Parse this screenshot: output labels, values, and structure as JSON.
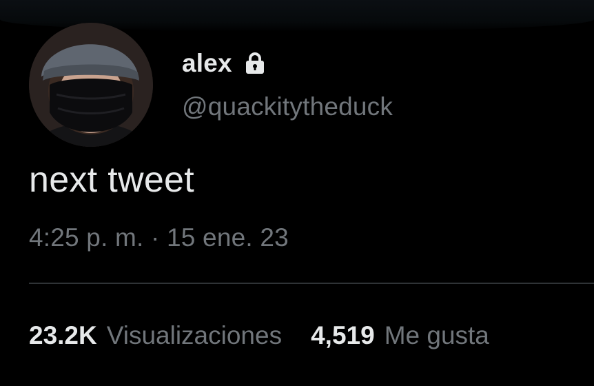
{
  "tweet": {
    "author": {
      "display_name": "alex",
      "handle": "@quackitytheduck",
      "protected_icon": "lock-icon",
      "avatar": "profile-avatar"
    },
    "text": "next tweet",
    "timestamp": "4:25 p. m. · 15 ene. 23",
    "stats": {
      "views_count": "23.2K",
      "views_label": "Visualizaciones",
      "likes_count": "4,519",
      "likes_label": "Me gusta"
    }
  },
  "colors": {
    "background": "#000000",
    "primary_text": "#e7e9ea",
    "secondary_text": "#71767b",
    "divider": "#2f3336"
  }
}
